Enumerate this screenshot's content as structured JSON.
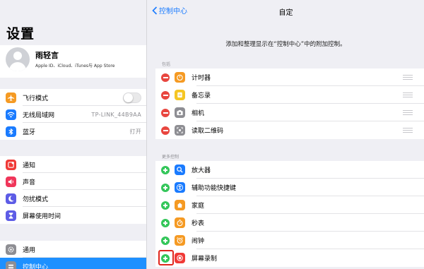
{
  "left": {
    "title": "设置",
    "profile": {
      "name": "雨轻言",
      "subtitle": "Apple ID、iCloud、iTunes与 App Store"
    },
    "group1": [
      {
        "icon": "airplane-icon",
        "color": "#f59a23",
        "label": "飞行模式",
        "toggle": false
      },
      {
        "icon": "wifi-icon",
        "color": "#1a7bff",
        "label": "无线局域网",
        "value": "TP-LINK_44B9AA"
      },
      {
        "icon": "bluetooth-icon",
        "color": "#1a7bff",
        "label": "蓝牙",
        "value": "打开"
      }
    ],
    "group2": [
      {
        "icon": "notifications-icon",
        "color": "#f03a37",
        "label": "通知"
      },
      {
        "icon": "sound-icon",
        "color": "#f0365a",
        "label": "声音"
      },
      {
        "icon": "moon-icon",
        "color": "#5d5ce6",
        "label": "勿扰模式"
      },
      {
        "icon": "hourglass-icon",
        "color": "#5d5ce6",
        "label": "屏幕使用时间"
      }
    ],
    "group3": [
      {
        "icon": "gear-icon",
        "color": "#8e8e93",
        "label": "通用"
      },
      {
        "icon": "control-center-icon",
        "color": "#8e8e93",
        "label": "控制中心",
        "selected": true
      }
    ]
  },
  "right": {
    "back_label": "控制中心",
    "title": "自定",
    "description": "添加和整理显示在“控制中心”中的附加控制。",
    "included_header": "包括",
    "included": [
      {
        "icon": "timer-icon",
        "color": "#f59a23",
        "label": "计时器"
      },
      {
        "icon": "notes-icon",
        "color": "#f5c623",
        "label": "备忘录"
      },
      {
        "icon": "camera-icon",
        "color": "#8e8e93",
        "label": "相机"
      },
      {
        "icon": "qr-code-icon",
        "color": "#8e8e93",
        "label": "读取二维码"
      }
    ],
    "more_header": "更多控制",
    "more": [
      {
        "icon": "magnifier-icon",
        "color": "#1a7bff",
        "label": "放大器"
      },
      {
        "icon": "accessibility-icon",
        "color": "#1a7bff",
        "label": "辅助功能快捷键"
      },
      {
        "icon": "home-icon",
        "color": "#f59a23",
        "label": "家庭"
      },
      {
        "icon": "stopwatch-icon",
        "color": "#f59a23",
        "label": "秒表"
      },
      {
        "icon": "alarm-icon",
        "color": "#f59a23",
        "label": "闹钟"
      },
      {
        "icon": "screen-record-icon",
        "color": "#f03a37",
        "label": "屏幕录制"
      }
    ]
  }
}
